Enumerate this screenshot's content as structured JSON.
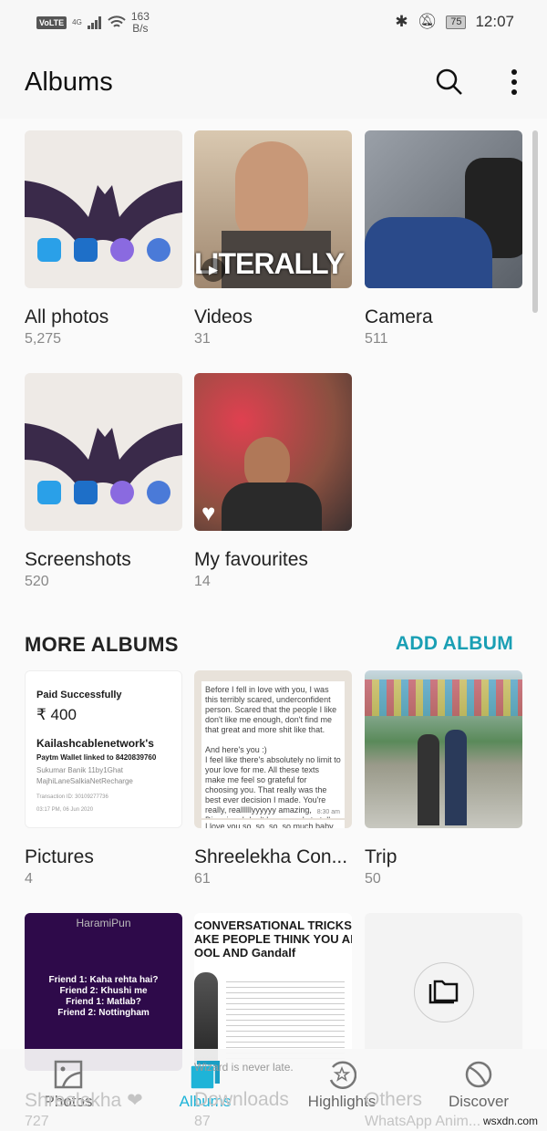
{
  "status_bar": {
    "volte": "VoLTE",
    "network": "4G",
    "speed_value": "163",
    "speed_unit": "B/s",
    "battery": "75",
    "time": "12:07"
  },
  "header": {
    "title": "Albums",
    "search_icon": "search-icon",
    "menu_icon": "more-vert-icon"
  },
  "albums": [
    {
      "name": "All photos",
      "count": "5,275"
    },
    {
      "name": "Videos",
      "count": "31",
      "overlay_text": "LITERALLY"
    },
    {
      "name": "Camera",
      "count": "511"
    },
    {
      "name": "Screenshots",
      "count": "520"
    },
    {
      "name": "My favourites",
      "count": "14"
    }
  ],
  "more_albums": {
    "title": "MORE ALBUMS",
    "add_label": "ADD ALBUM",
    "items": [
      {
        "name": "Pictures",
        "count": "4",
        "thumb": {
          "l1": "Paid Successfully",
          "l2": "₹ 400",
          "l3": "Kailashcablenetwork's",
          "l4": "Paytm Wallet linked to 8420839760",
          "l5": "Sukumar Banik 11by1Ghat",
          "l6": "MajhiLaneSalkiaNetRecharge",
          "l7": "Transaction ID: 30109277736",
          "l8": "03:17 PM, 06 Jun 2020"
        }
      },
      {
        "name": "Shreelekha Con...",
        "count": "61",
        "thumb": {
          "p1": "Before I fell in love with you, I was this terribly scared, underconfident person. Scared that the people I like don't like me enough, don't find me that great and more shit like that.",
          "p2": "And here's you :)",
          "p3": "I feel like there's absolutely no limit to your love for me. All these texts make me feel so grateful for choosing you. That really was the best ever decision I made. You're really, reallllllyyyyyy amazing, Dipanjan. I don't have words to tell you what I'm feeling right now and how beautiful this text is. ❤",
          "time": "8:30 am",
          "p4": "I love you so, so, so, so much baby"
        }
      },
      {
        "name": "Trip",
        "count": "50"
      },
      {
        "name": "Shreelekha ❤",
        "count": "727",
        "thumb": {
          "header": "HaramiPun",
          "lines": [
            "Friend 1: Kaha rehta hai?",
            "Friend 2: Khushi me",
            "Friend 1: Matlab?",
            "Friend 2: Nottingham"
          ]
        }
      },
      {
        "name": "Downloads",
        "count": "87",
        "thumb": {
          "t1": "CONVERSATIONAL TRICKS TO",
          "t2": "AKE PEOPLE THINK YOU ARE",
          "t3": "OOL AND Gandalf",
          "caption": "Wizard is never late."
        }
      },
      {
        "name": "Others",
        "count": "WhatsApp Anim...",
        "icon": "folder-icon"
      }
    ]
  },
  "nav": [
    {
      "label": "Photos",
      "icon": "image-icon"
    },
    {
      "label": "Albums",
      "icon": "albums-icon",
      "active": true
    },
    {
      "label": "Highlights",
      "icon": "highlights-icon"
    },
    {
      "label": "Discover",
      "icon": "discover-icon"
    }
  ],
  "colors": {
    "accent": "#1a9fb4",
    "nav_active": "#1eb4d8"
  },
  "watermark": "wsxdn.com"
}
